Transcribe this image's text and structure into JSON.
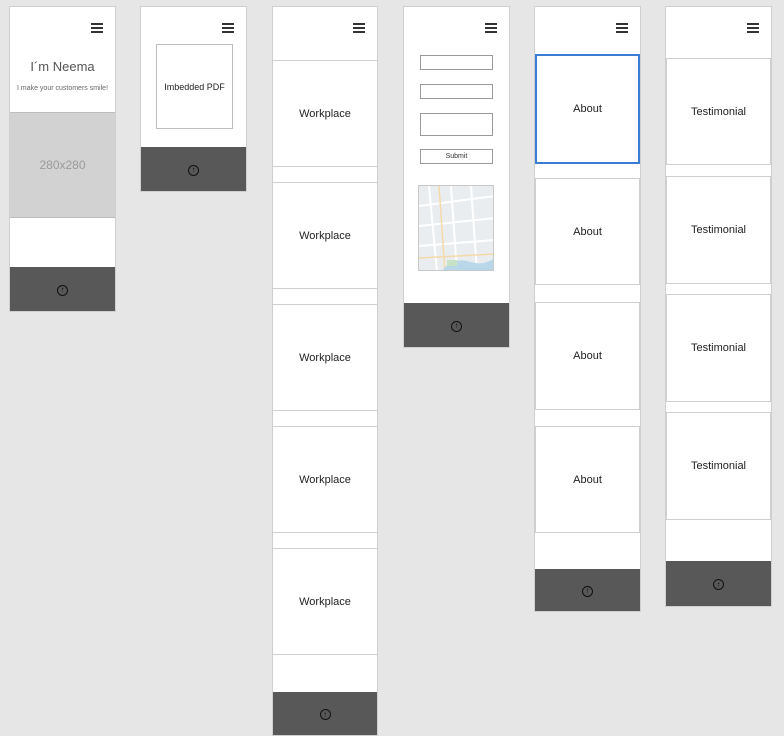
{
  "screen1": {
    "title": "I´m Neema",
    "subtitle": "I make your customers smile!",
    "image_placeholder": "280x280"
  },
  "screen2": {
    "pdf_label": "Imbedded PDF"
  },
  "screen3": {
    "cards": [
      {
        "label": "Workplace"
      },
      {
        "label": "Workplace"
      },
      {
        "label": "Workplace"
      },
      {
        "label": "Workplace"
      },
      {
        "label": "Workplace"
      }
    ]
  },
  "screen4": {
    "submit_label": "Submit"
  },
  "screen5": {
    "cards": [
      {
        "label": "About"
      },
      {
        "label": "About"
      },
      {
        "label": "About"
      },
      {
        "label": "About"
      }
    ]
  },
  "screen6": {
    "cards": [
      {
        "label": "Testimonial"
      },
      {
        "label": "Testimonial"
      },
      {
        "label": "Testimonial"
      },
      {
        "label": "Testimonial"
      }
    ]
  },
  "colors": {
    "canvas": "#e6e6e6",
    "footer": "#585858",
    "selected_border": "#3a7bd5"
  },
  "icons": {
    "menu": "hamburger-menu-icon",
    "back_to_top": "arrow-up-circle-icon"
  }
}
